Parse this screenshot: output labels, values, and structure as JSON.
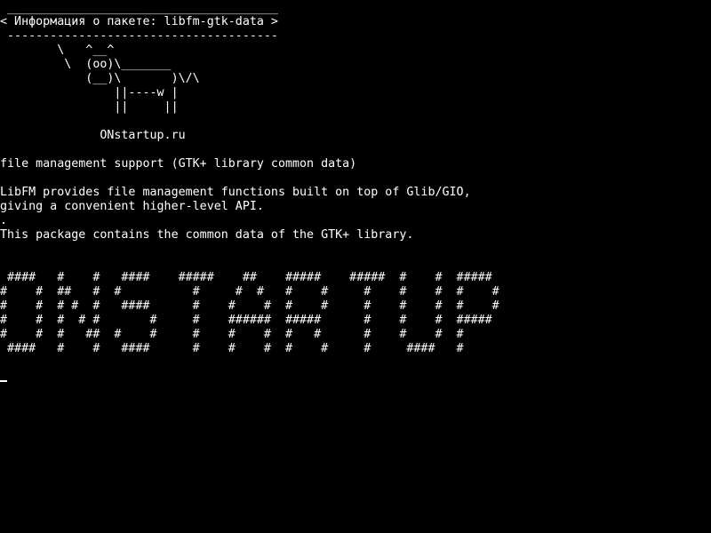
{
  "terminal": {
    "colors": {
      "background": "#000000",
      "foreground": "#ffffff"
    },
    "cowsay": {
      "border_top": " ______________________________________",
      "title_line": "< Информация о пакете: libfm-gtk-data >",
      "border_bottom": " --------------------------------------",
      "cow": "        \\   ^__^\n         \\  (oo)\\_______\n            (__)\\       )\\/\\\n                ||----w |\n                ||     ||",
      "credit": "              ONstartup.ru"
    },
    "package": {
      "summary": "file management support (GTK+ library common data)",
      "description_line1": "LibFM provides file management functions built on top of Glib/GIO,",
      "description_line2": "giving a convenient higher-level API.",
      "separator": ".",
      "description_line3": "This package contains the common data of the GTK+ library."
    },
    "banner": " ####   #    #   ####    #####    ##    #####    #####  #    #  #####\n#    #  ##   #  #          #     #  #   #    #     #    #    #  #    #\n#    #  # #  #   ####      #    #    #  #    #     #    #    #  #    #\n#    #  #  # #       #     #    ######  #####      #    #    #  #####\n#    #  #   ##  #    #     #    #    #  #   #      #    #    #  #\n ####   #    #   ####      #    #    #  #    #     #     ####   #",
    "cursor": "cursor-block"
  }
}
